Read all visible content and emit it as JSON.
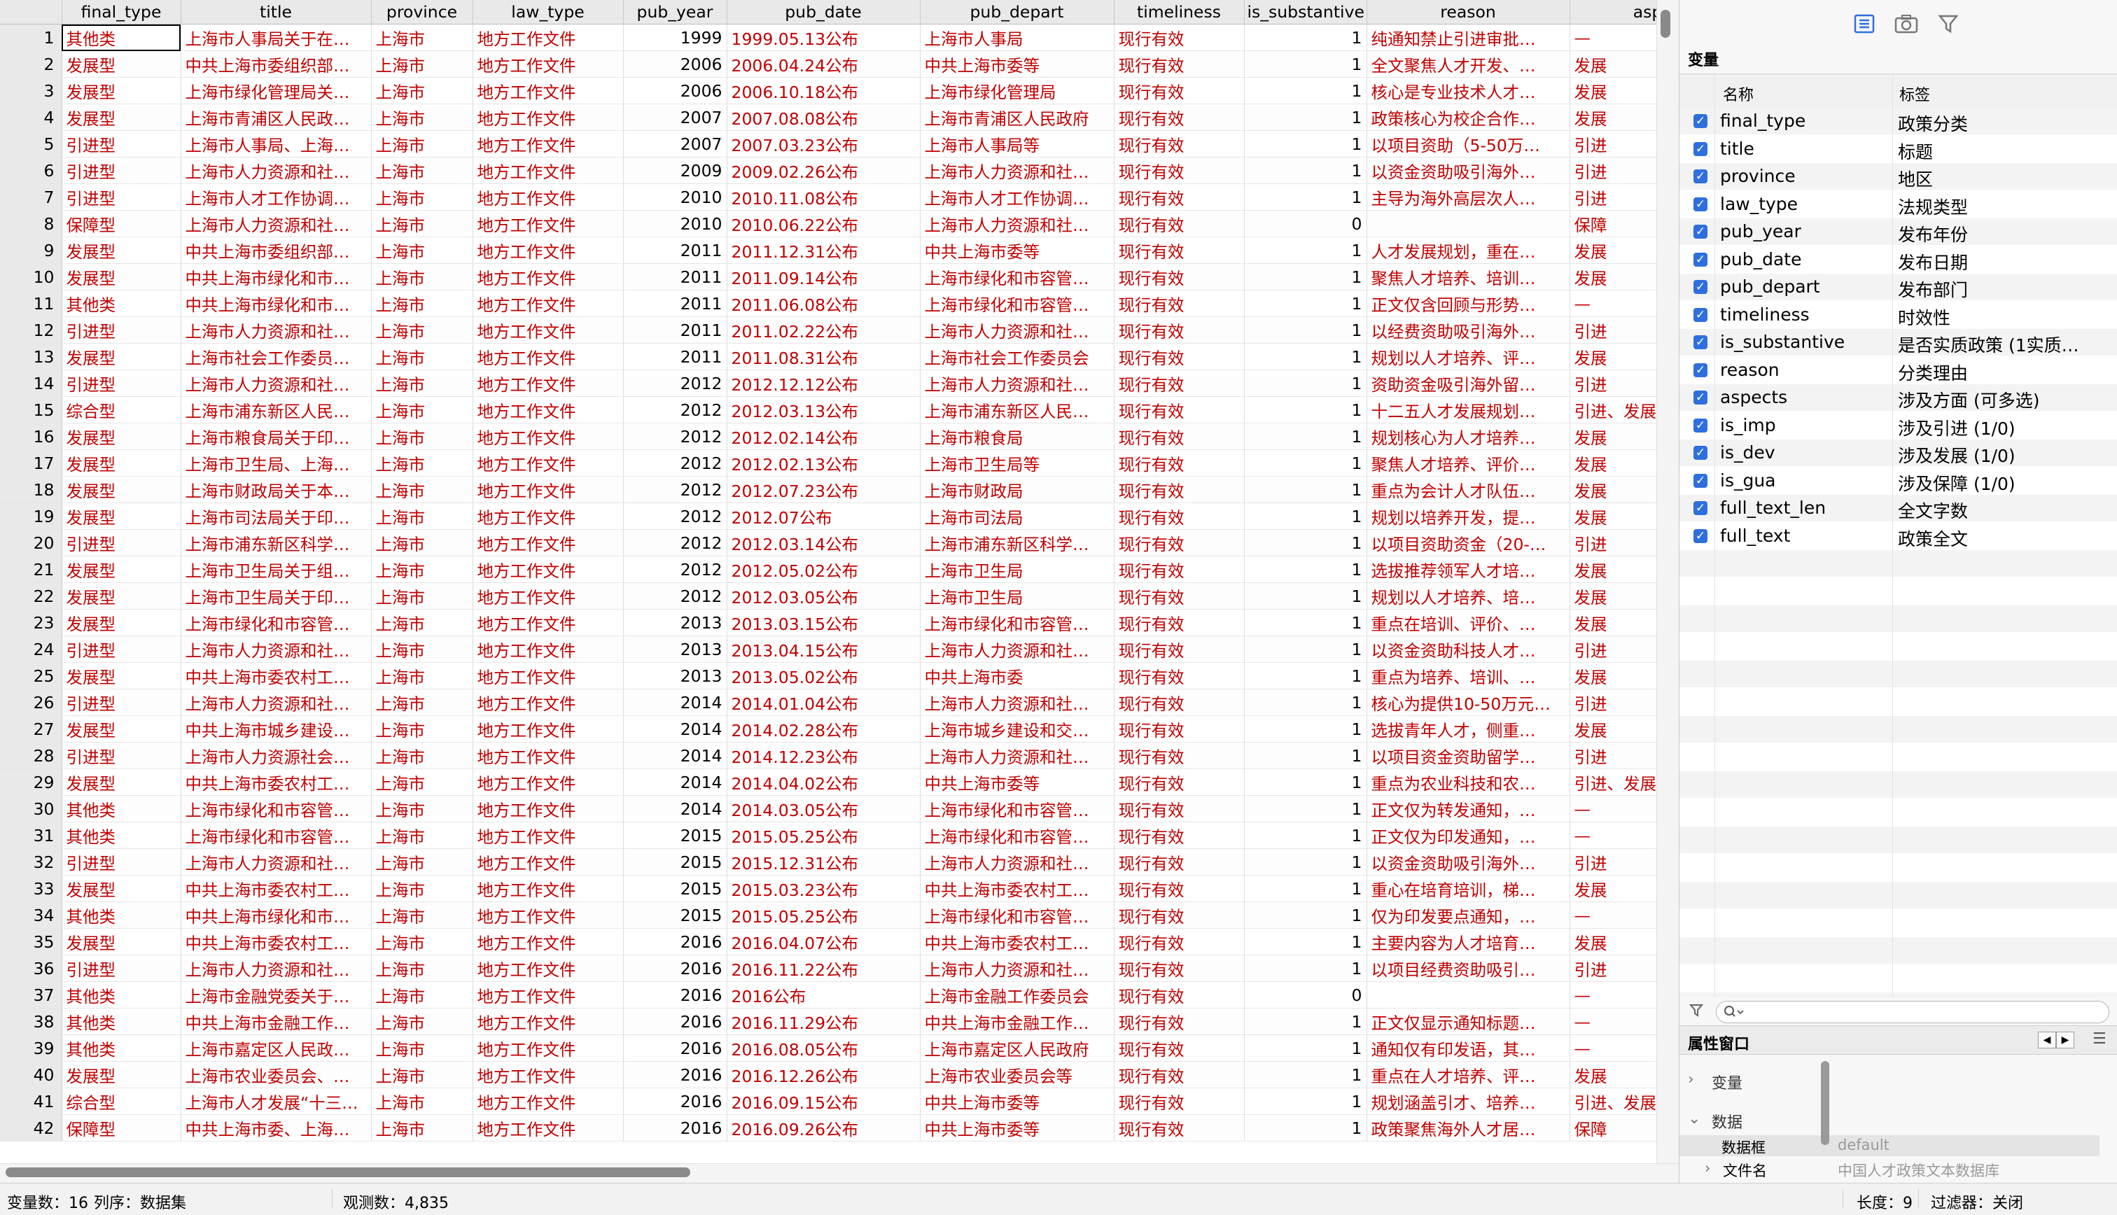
{
  "grid": {
    "columns": [
      "final_type",
      "title",
      "province",
      "law_type",
      "pub_year",
      "pub_date",
      "pub_depart",
      "timeliness",
      "is_substantive",
      "reason",
      "asp"
    ],
    "rows": [
      [
        "1",
        "其他类",
        "上海市人事局关于在…",
        "上海市",
        "地方工作文件",
        "1999",
        "1999.05.13公布",
        "上海市人事局",
        "现行有效",
        "1",
        "纯通知禁止引进审批…",
        "—"
      ],
      [
        "2",
        "发展型",
        "中共上海市委组织部…",
        "上海市",
        "地方工作文件",
        "2006",
        "2006.04.24公布",
        "中共上海市委等",
        "现行有效",
        "1",
        "全文聚焦人才开发、…",
        "发展"
      ],
      [
        "3",
        "发展型",
        "上海市绿化管理局关…",
        "上海市",
        "地方工作文件",
        "2006",
        "2006.10.18公布",
        "上海市绿化管理局",
        "现行有效",
        "1",
        "核心是专业技术人才…",
        "发展"
      ],
      [
        "4",
        "发展型",
        "上海市青浦区人民政…",
        "上海市",
        "地方工作文件",
        "2007",
        "2007.08.08公布",
        "上海市青浦区人民政府",
        "现行有效",
        "1",
        "政策核心为校企合作…",
        "发展"
      ],
      [
        "5",
        "引进型",
        "上海市人事局、上海…",
        "上海市",
        "地方工作文件",
        "2007",
        "2007.03.23公布",
        "上海市人事局等",
        "现行有效",
        "1",
        "以项目资助（5-50万…",
        "引进"
      ],
      [
        "6",
        "引进型",
        "上海市人力资源和社…",
        "上海市",
        "地方工作文件",
        "2009",
        "2009.02.26公布",
        "上海市人力资源和社…",
        "现行有效",
        "1",
        "以资金资助吸引海外…",
        "引进"
      ],
      [
        "7",
        "引进型",
        "上海市人才工作协调…",
        "上海市",
        "地方工作文件",
        "2010",
        "2010.11.08公布",
        "上海市人才工作协调…",
        "现行有效",
        "1",
        "主导为海外高层次人…",
        "引进"
      ],
      [
        "8",
        "保障型",
        "上海市人力资源和社…",
        "上海市",
        "地方工作文件",
        "2010",
        "2010.06.22公布",
        "上海市人力资源和社…",
        "现行有效",
        "0",
        "",
        "保障"
      ],
      [
        "9",
        "发展型",
        "中共上海市委组织部…",
        "上海市",
        "地方工作文件",
        "2011",
        "2011.12.31公布",
        "中共上海市委等",
        "现行有效",
        "1",
        "人才发展规划，重在…",
        "发展"
      ],
      [
        "10",
        "发展型",
        "中共上海市绿化和市…",
        "上海市",
        "地方工作文件",
        "2011",
        "2011.09.14公布",
        "上海市绿化和市容管…",
        "现行有效",
        "1",
        "聚焦人才培养、培训…",
        "发展"
      ],
      [
        "11",
        "其他类",
        "中共上海市绿化和市…",
        "上海市",
        "地方工作文件",
        "2011",
        "2011.06.08公布",
        "上海市绿化和市容管…",
        "现行有效",
        "1",
        "正文仅含回顾与形势…",
        "—"
      ],
      [
        "12",
        "引进型",
        "上海市人力资源和社…",
        "上海市",
        "地方工作文件",
        "2011",
        "2011.02.22公布",
        "上海市人力资源和社…",
        "现行有效",
        "1",
        "以经费资助吸引海外…",
        "引进"
      ],
      [
        "13",
        "发展型",
        "上海市社会工作委员…",
        "上海市",
        "地方工作文件",
        "2011",
        "2011.08.31公布",
        "上海市社会工作委员会",
        "现行有效",
        "1",
        "规划以人才培养、评…",
        "发展"
      ],
      [
        "14",
        "引进型",
        "上海市人力资源和社…",
        "上海市",
        "地方工作文件",
        "2012",
        "2012.12.12公布",
        "上海市人力资源和社…",
        "现行有效",
        "1",
        "资助资金吸引海外留…",
        "引进"
      ],
      [
        "15",
        "综合型",
        "上海市浦东新区人民…",
        "上海市",
        "地方工作文件",
        "2012",
        "2012.03.13公布",
        "上海市浦东新区人民…",
        "现行有效",
        "1",
        "十二五人才发展规划…",
        "引进、发展、保"
      ],
      [
        "16",
        "发展型",
        "上海市粮食局关于印…",
        "上海市",
        "地方工作文件",
        "2012",
        "2012.02.14公布",
        "上海市粮食局",
        "现行有效",
        "1",
        "规划核心为人才培养…",
        "发展"
      ],
      [
        "17",
        "发展型",
        "上海市卫生局、上海…",
        "上海市",
        "地方工作文件",
        "2012",
        "2012.02.13公布",
        "上海市卫生局等",
        "现行有效",
        "1",
        "聚焦人才培养、评价…",
        "发展"
      ],
      [
        "18",
        "发展型",
        "上海市财政局关于本…",
        "上海市",
        "地方工作文件",
        "2012",
        "2012.07.23公布",
        "上海市财政局",
        "现行有效",
        "1",
        "重点为会计人才队伍…",
        "发展"
      ],
      [
        "19",
        "发展型",
        "上海市司法局关于印…",
        "上海市",
        "地方工作文件",
        "2012",
        "2012.07公布",
        "上海市司法局",
        "现行有效",
        "1",
        "规划以培养开发，提…",
        "发展"
      ],
      [
        "20",
        "引进型",
        "上海市浦东新区科学…",
        "上海市",
        "地方工作文件",
        "2012",
        "2012.03.14公布",
        "上海市浦东新区科学…",
        "现行有效",
        "1",
        "以项目资助资金（20-…",
        "引进"
      ],
      [
        "21",
        "发展型",
        "上海市卫生局关于组…",
        "上海市",
        "地方工作文件",
        "2012",
        "2012.05.02公布",
        "上海市卫生局",
        "现行有效",
        "1",
        "选拔推荐领军人才培…",
        "发展"
      ],
      [
        "22",
        "发展型",
        "上海市卫生局关于印…",
        "上海市",
        "地方工作文件",
        "2012",
        "2012.03.05公布",
        "上海市卫生局",
        "现行有效",
        "1",
        "规划以人才培养、培…",
        "发展"
      ],
      [
        "23",
        "发展型",
        "上海市绿化和市容管…",
        "上海市",
        "地方工作文件",
        "2013",
        "2013.03.15公布",
        "上海市绿化和市容管…",
        "现行有效",
        "1",
        "重点在培训、评价、…",
        "发展"
      ],
      [
        "24",
        "引进型",
        "上海市人力资源和社…",
        "上海市",
        "地方工作文件",
        "2013",
        "2013.04.15公布",
        "上海市人力资源和社…",
        "现行有效",
        "1",
        "以资金资助科技人才…",
        "引进"
      ],
      [
        "25",
        "发展型",
        "中共上海市委农村工…",
        "上海市",
        "地方工作文件",
        "2013",
        "2013.05.02公布",
        "中共上海市委",
        "现行有效",
        "1",
        "重点为培养、培训、…",
        "发展"
      ],
      [
        "26",
        "引进型",
        "上海市人力资源和社…",
        "上海市",
        "地方工作文件",
        "2014",
        "2014.01.04公布",
        "上海市人力资源和社…",
        "现行有效",
        "1",
        "核心为提供10-50万元…",
        "引进"
      ],
      [
        "27",
        "发展型",
        "中共上海市城乡建设…",
        "上海市",
        "地方工作文件",
        "2014",
        "2014.02.28公布",
        "上海市城乡建设和交…",
        "现行有效",
        "1",
        "选拔青年人才，侧重…",
        "发展"
      ],
      [
        "28",
        "引进型",
        "上海市人力资源社会…",
        "上海市",
        "地方工作文件",
        "2014",
        "2014.12.23公布",
        "上海市人力资源和社…",
        "现行有效",
        "1",
        "以项目资金资助留学…",
        "引进"
      ],
      [
        "29",
        "发展型",
        "中共上海市委农村工…",
        "上海市",
        "地方工作文件",
        "2014",
        "2014.04.02公布",
        "中共上海市委等",
        "现行有效",
        "1",
        "重点为农业科技和农…",
        "引进、发展、保"
      ],
      [
        "30",
        "其他类",
        "上海市绿化和市容管…",
        "上海市",
        "地方工作文件",
        "2014",
        "2014.03.05公布",
        "上海市绿化和市容管…",
        "现行有效",
        "1",
        "正文仅为转发通知，…",
        "—"
      ],
      [
        "31",
        "其他类",
        "上海市绿化和市容管…",
        "上海市",
        "地方工作文件",
        "2015",
        "2015.05.25公布",
        "上海市绿化和市容管…",
        "现行有效",
        "1",
        "正文仅为印发通知，…",
        "—"
      ],
      [
        "32",
        "引进型",
        "上海市人力资源和社…",
        "上海市",
        "地方工作文件",
        "2015",
        "2015.12.31公布",
        "上海市人力资源和社…",
        "现行有效",
        "1",
        "以资金资助吸引海外…",
        "引进"
      ],
      [
        "33",
        "发展型",
        "中共上海市委农村工…",
        "上海市",
        "地方工作文件",
        "2015",
        "2015.03.23公布",
        "中共上海市委农村工…",
        "现行有效",
        "1",
        "重心在培育培训，梯…",
        "发展"
      ],
      [
        "34",
        "其他类",
        "中共上海市绿化和市…",
        "上海市",
        "地方工作文件",
        "2015",
        "2015.05.25公布",
        "上海市绿化和市容管…",
        "现行有效",
        "1",
        "仅为印发要点通知，…",
        "—"
      ],
      [
        "35",
        "发展型",
        "中共上海市委农村工…",
        "上海市",
        "地方工作文件",
        "2016",
        "2016.04.07公布",
        "中共上海市委农村工…",
        "现行有效",
        "1",
        "主要内容为人才培育…",
        "发展"
      ],
      [
        "36",
        "引进型",
        "上海市人力资源和社…",
        "上海市",
        "地方工作文件",
        "2016",
        "2016.11.22公布",
        "上海市人力资源和社…",
        "现行有效",
        "1",
        "以项目经费资助吸引…",
        "引进"
      ],
      [
        "37",
        "其他类",
        "上海市金融党委关于…",
        "上海市",
        "地方工作文件",
        "2016",
        "2016公布",
        "上海市金融工作委员会",
        "现行有效",
        "0",
        "",
        "—"
      ],
      [
        "38",
        "其他类",
        "中共上海市金融工作…",
        "上海市",
        "地方工作文件",
        "2016",
        "2016.11.29公布",
        "中共上海市金融工作…",
        "现行有效",
        "1",
        "正文仅显示通知标题…",
        "—"
      ],
      [
        "39",
        "其他类",
        "上海市嘉定区人民政…",
        "上海市",
        "地方工作文件",
        "2016",
        "2016.08.05公布",
        "上海市嘉定区人民政府",
        "现行有效",
        "1",
        "通知仅有印发语，其…",
        "—"
      ],
      [
        "40",
        "发展型",
        "上海市农业委员会、…",
        "上海市",
        "地方工作文件",
        "2016",
        "2016.12.26公布",
        "上海市农业委员会等",
        "现行有效",
        "1",
        "重点在人才培养、评…",
        "发展"
      ],
      [
        "41",
        "综合型",
        "上海市人才发展“十三…",
        "上海市",
        "地方工作文件",
        "2016",
        "2016.09.15公布",
        "中共上海市委等",
        "现行有效",
        "1",
        "规划涵盖引才、培养…",
        "引进、发展、保"
      ],
      [
        "42",
        "保障型",
        "中共上海市委、上海…",
        "上海市",
        "地方工作文件",
        "2016",
        "2016.09.26公布",
        "中共上海市委等",
        "现行有效",
        "1",
        "政策聚焦海外人才居…",
        "保障"
      ]
    ]
  },
  "panel": {
    "variables_title": "变量",
    "col_name": "名称",
    "col_label": "标签",
    "variables": [
      {
        "name": "final_type",
        "label": "政策分类"
      },
      {
        "name": "title",
        "label": "标题"
      },
      {
        "name": "province",
        "label": "地区"
      },
      {
        "name": "law_type",
        "label": "法规类型"
      },
      {
        "name": "pub_year",
        "label": "发布年份"
      },
      {
        "name": "pub_date",
        "label": "发布日期"
      },
      {
        "name": "pub_depart",
        "label": "发布部门"
      },
      {
        "name": "timeliness",
        "label": "时效性"
      },
      {
        "name": "is_substantive",
        "label": "是否实质政策 (1实质…"
      },
      {
        "name": "reason",
        "label": "分类理由"
      },
      {
        "name": "aspects",
        "label": "涉及方面 (可多选)"
      },
      {
        "name": "is_imp",
        "label": "涉及引进 (1/0)"
      },
      {
        "name": "is_dev",
        "label": "涉及发展 (1/0)"
      },
      {
        "name": "is_gua",
        "label": "涉及保障 (1/0)"
      },
      {
        "name": "full_text_len",
        "label": "全文字数"
      },
      {
        "name": "full_text",
        "label": "政策全文"
      }
    ],
    "properties_title": "属性窗口",
    "sec_variables": "变量",
    "sec_data": "数据",
    "frame_key": "数据框",
    "frame_value": "default",
    "filename_key": "文件名",
    "filename_value": "中国人才政策文本数据库"
  },
  "status": {
    "vars": "变量数：16",
    "order": "列序：数据集",
    "obs": "观测数：4,835",
    "length": "长度：9",
    "filter": "过滤器：关闭"
  }
}
